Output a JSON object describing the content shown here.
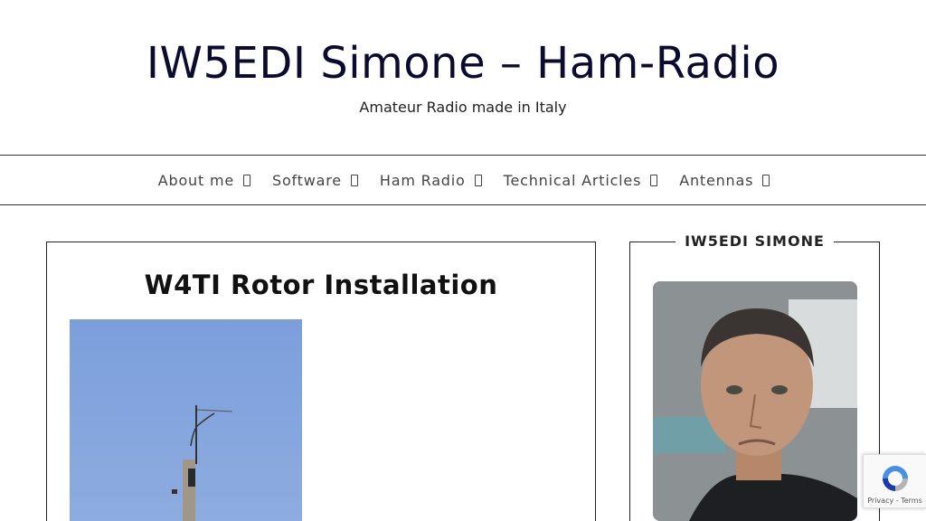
{
  "header": {
    "title": "IW5EDI Simone – Ham-Radio",
    "tagline": "Amateur Radio made in Italy"
  },
  "nav": {
    "items": [
      {
        "label": "About me"
      },
      {
        "label": "Software"
      },
      {
        "label": "Ham Radio"
      },
      {
        "label": "Technical Articles"
      },
      {
        "label": "Antennas"
      }
    ]
  },
  "post": {
    "title": "W4TI Rotor Installation",
    "image_icon": "antenna-mast-photo"
  },
  "sidebar": {
    "title": "IW5EDI SIMONE",
    "photo_icon": "profile-photo"
  },
  "recaptcha": {
    "privacy": "Privacy",
    "separator": "-",
    "terms": "Terms"
  },
  "colors": {
    "title": "#0b0b2e",
    "border": "#222222",
    "sky": "#86a6de"
  }
}
